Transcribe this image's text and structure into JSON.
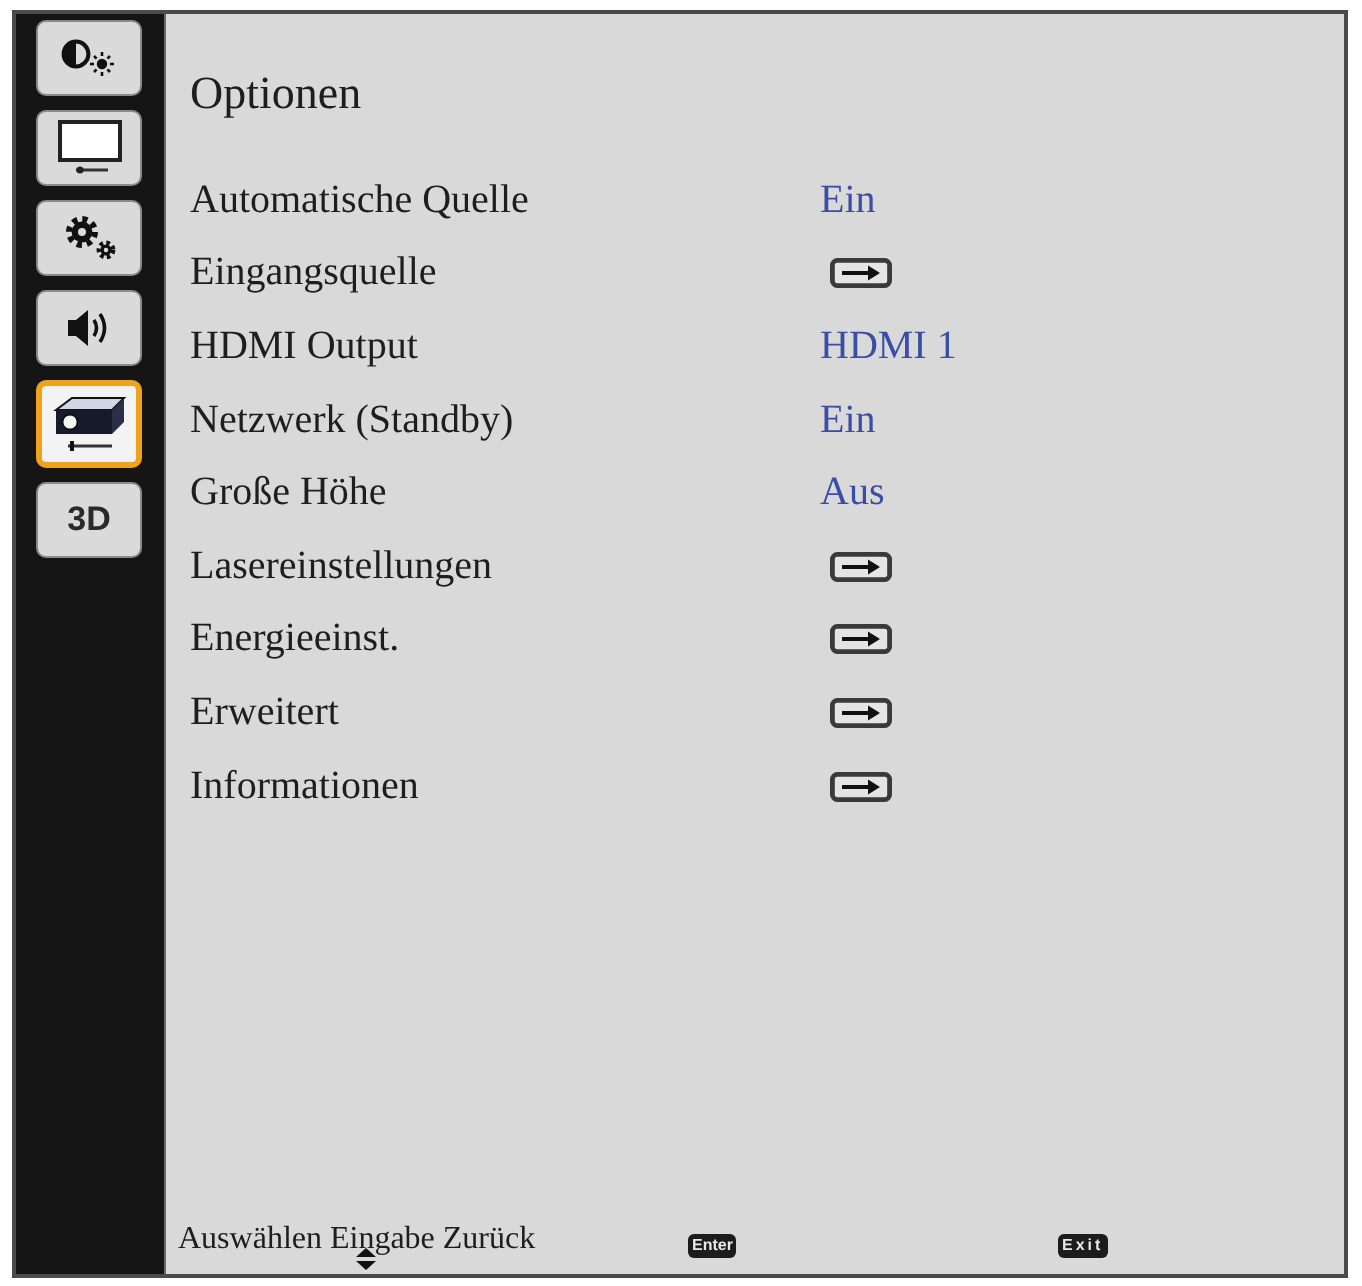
{
  "sidebar": {
    "items": [
      {
        "kind": "contrast",
        "selected": false
      },
      {
        "kind": "display",
        "selected": false
      },
      {
        "kind": "settings",
        "selected": false
      },
      {
        "kind": "audio",
        "selected": false
      },
      {
        "kind": "projector",
        "selected": true
      },
      {
        "kind": "label",
        "label": "3D",
        "selected": false
      }
    ]
  },
  "menu": {
    "title": "Optionen",
    "rows": [
      {
        "kind": "value",
        "label": "Automatische Quelle",
        "value": "Ein"
      },
      {
        "kind": "submenu",
        "label": "Eingangsquelle"
      },
      {
        "kind": "value",
        "label": "HDMI Output",
        "value": "HDMI 1"
      },
      {
        "kind": "value",
        "label": "Netzwerk (Standby)",
        "value": "Ein"
      },
      {
        "kind": "value",
        "label": "Große Höhe",
        "value": "Aus"
      },
      {
        "kind": "submenu",
        "label": "Lasereinstellungen"
      },
      {
        "kind": "submenu",
        "label": "Energieeinst."
      },
      {
        "kind": "submenu",
        "label": "Erweitert"
      },
      {
        "kind": "submenu",
        "label": "Informationen"
      }
    ]
  },
  "footer": {
    "hint": "Auswählen Eingabe Zurück",
    "keys": [
      {
        "label": "Enter"
      },
      {
        "label": "Exit"
      }
    ]
  }
}
